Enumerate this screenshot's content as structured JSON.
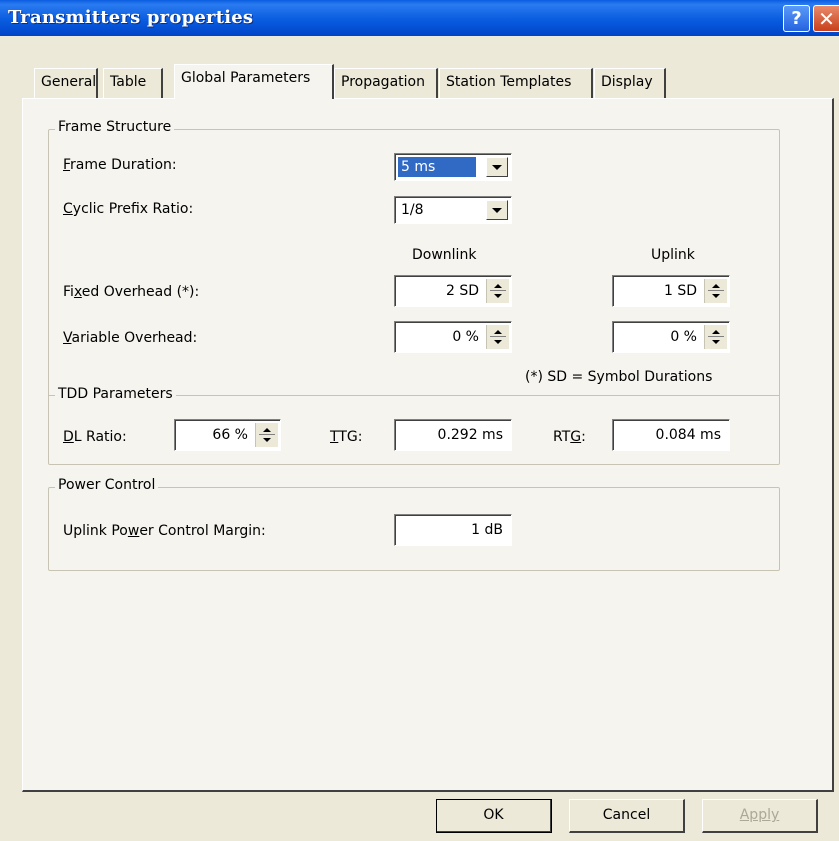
{
  "window": {
    "title": "Transmitters properties",
    "help_glyph": "?",
    "close_glyph": "✕"
  },
  "tabs": [
    {
      "label": "General"
    },
    {
      "label": "Table"
    },
    {
      "label": "Global Parameters"
    },
    {
      "label": "Propagation"
    },
    {
      "label": "Station Templates"
    },
    {
      "label": "Display"
    }
  ],
  "active_tab": "Global Parameters",
  "frame_structure": {
    "title": "Frame Structure",
    "frame_duration": {
      "label_accel": "F",
      "label_rest": "rame Duration:",
      "value": "5 ms"
    },
    "cyclic_prefix": {
      "label_accel": "C",
      "label_rest": "yclic Prefix Ratio:",
      "value": "1/8"
    },
    "col_downlink": "Downlink",
    "col_uplink": "Uplink",
    "fixed_overhead": {
      "label_pre": "Fi",
      "label_accel": "x",
      "label_rest": "ed Overhead (*):",
      "downlink": "2 SD",
      "uplink": "1 SD"
    },
    "variable_overhead": {
      "label_accel": "V",
      "label_rest": "ariable Overhead:",
      "downlink": "0 %",
      "uplink": "0 %"
    },
    "footnote": "(*) SD = Symbol Durations"
  },
  "tdd": {
    "title": "TDD Parameters",
    "dl_ratio": {
      "label_accel": "D",
      "label_rest": "L Ratio:",
      "value": "66 %"
    },
    "ttg": {
      "label_accel": "T",
      "label_rest": "TG:",
      "value": "0.292 ms"
    },
    "rtg": {
      "label_pre": "RT",
      "label_accel": "G",
      "label_rest": ":",
      "value": "0.084 ms"
    }
  },
  "power_control": {
    "title": "Power Control",
    "margin": {
      "label_pre": "Uplink Po",
      "label_accel": "w",
      "label_rest": "er Control Margin:",
      "value": "1 dB"
    }
  },
  "buttons": {
    "ok": "OK",
    "cancel": "Cancel",
    "apply": "Apply"
  }
}
